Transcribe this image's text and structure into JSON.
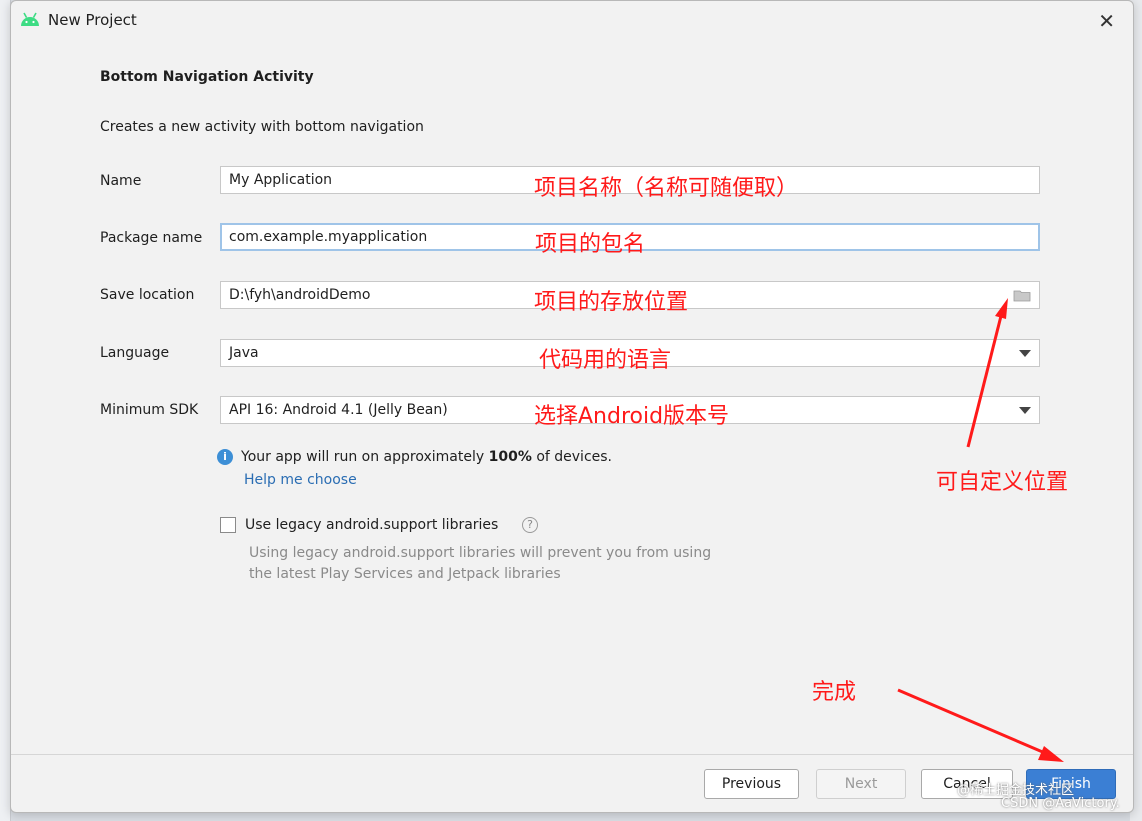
{
  "window": {
    "title": "New Project"
  },
  "header": {
    "heading": "Bottom Navigation Activity",
    "description": "Creates a new activity with bottom navigation"
  },
  "form": {
    "name": {
      "label": "Name",
      "value": "My Application"
    },
    "package": {
      "label": "Package name",
      "value": "com.example.myapplication"
    },
    "location": {
      "label": "Save location",
      "value": "D:\\fyh\\androidDemo"
    },
    "language": {
      "label": "Language",
      "value": "Java"
    },
    "min_sdk": {
      "label": "Minimum SDK",
      "value": "API 16: Android 4.1 (Jelly Bean)"
    }
  },
  "info": {
    "text_before": "Your app will run on approximately ",
    "percent": "100%",
    "text_after": " of devices.",
    "help_link": "Help me choose"
  },
  "legacy": {
    "label": "Use legacy android.support libraries",
    "checked": false,
    "hint_line1": "Using legacy android.support libraries will prevent you from using",
    "hint_line2": "the latest Play Services and Jetpack libraries"
  },
  "buttons": {
    "previous": "Previous",
    "next": "Next",
    "cancel": "Cancel",
    "finish": "Finish"
  },
  "annotations": {
    "name_note": "项目名称（名称可随便取）",
    "package_note": "项目的包名",
    "location_note": "项目的存放位置",
    "language_note": "代码用的语言",
    "sdk_note": "选择Android版本号",
    "custom_location_note": "可自定义位置",
    "finish_note": "完成",
    "color": "#ff1a1a"
  },
  "watermark": {
    "line1": "@稀土掘金技术社区",
    "line2": "CSDN @AaVictory."
  },
  "colors": {
    "accent": "#3b7fd4",
    "link": "#2a6db3",
    "annotation": "#ff1a1a"
  }
}
